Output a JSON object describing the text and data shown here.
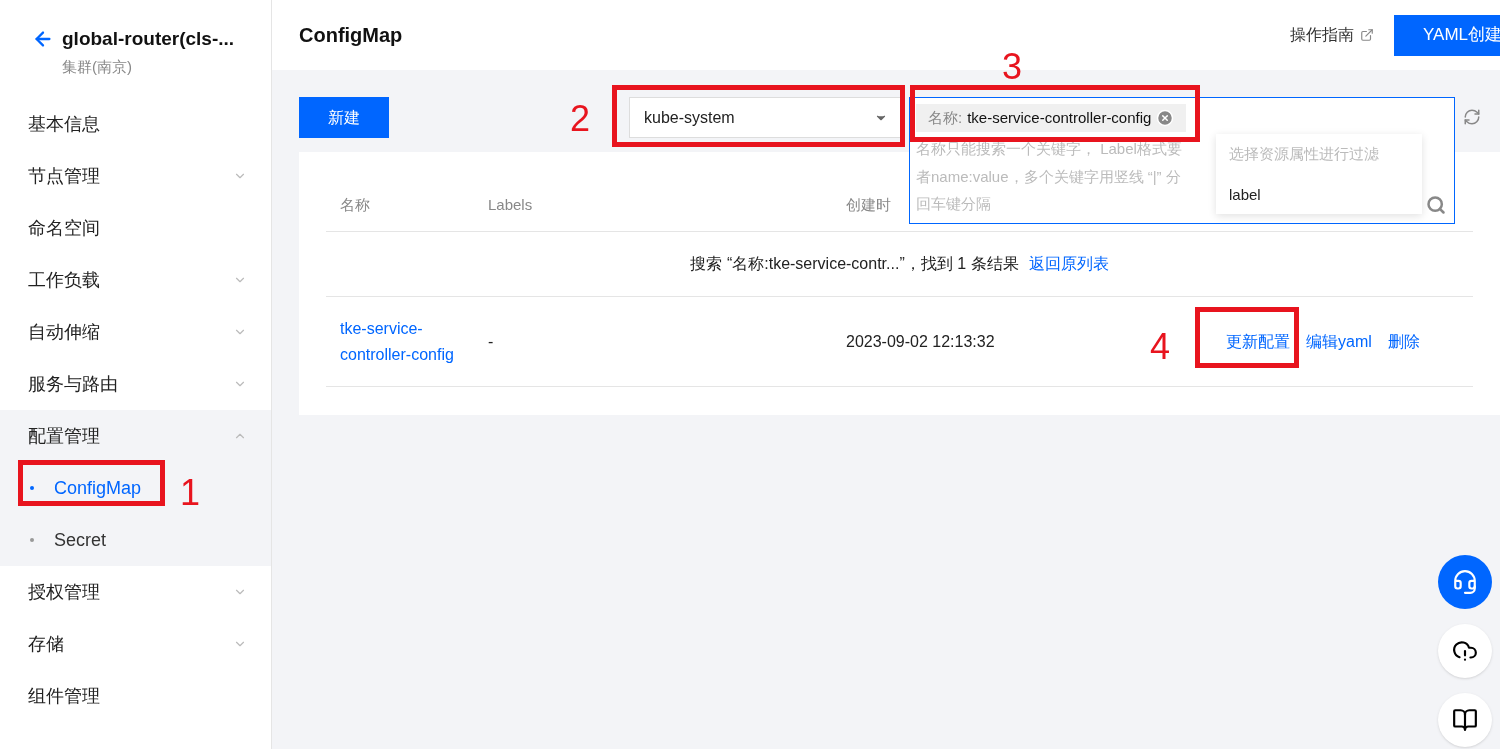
{
  "sidebar": {
    "cluster_name": "global-router(cls-...",
    "cluster_region": "集群(南京)",
    "items": [
      {
        "label": "基本信息",
        "expandable": false,
        "expanded": false
      },
      {
        "label": "节点管理",
        "expandable": true,
        "expanded": false
      },
      {
        "label": "命名空间",
        "expandable": false,
        "expanded": false
      },
      {
        "label": "工作负载",
        "expandable": true,
        "expanded": false
      },
      {
        "label": "自动伸缩",
        "expandable": true,
        "expanded": false
      },
      {
        "label": "服务与路由",
        "expandable": true,
        "expanded": false
      },
      {
        "label": "配置管理",
        "expandable": true,
        "expanded": true,
        "children": [
          {
            "label": "ConfigMap",
            "selected": true
          },
          {
            "label": "Secret",
            "selected": false
          }
        ]
      },
      {
        "label": "授权管理",
        "expandable": true,
        "expanded": false
      },
      {
        "label": "存储",
        "expandable": true,
        "expanded": false
      },
      {
        "label": "组件管理",
        "expandable": false,
        "expanded": false
      }
    ]
  },
  "header": {
    "title": "ConfigMap",
    "guide_link": "操作指南",
    "yaml_button": "YAML创建"
  },
  "toolbar": {
    "create_button": "新建",
    "namespace": "kube-system",
    "search": {
      "tag_key": "名称:",
      "tag_value": "tke-service-controller-config",
      "hint_lines": [
        "名称只能搜索一个关键字， Label格式要",
        "者name:value，多个关键字用竖线 “|” 分",
        "回车键分隔"
      ],
      "dropdown_title": "选择资源属性进行过滤",
      "dropdown_items": [
        "label"
      ]
    }
  },
  "table": {
    "columns": [
      "名称",
      "Labels",
      "创建时"
    ],
    "search_summary": "搜索 “名称:tke-service-contr...”，找到 1 条结果",
    "back_link": "返回原列表",
    "rows": [
      {
        "name": "tke-service-controller-config",
        "labels": "-",
        "created": "2023-09-02 12:13:32",
        "actions": [
          "更新配置",
          "编辑yaml",
          "删除"
        ]
      }
    ]
  },
  "annotations": [
    "1",
    "2",
    "3",
    "4"
  ]
}
